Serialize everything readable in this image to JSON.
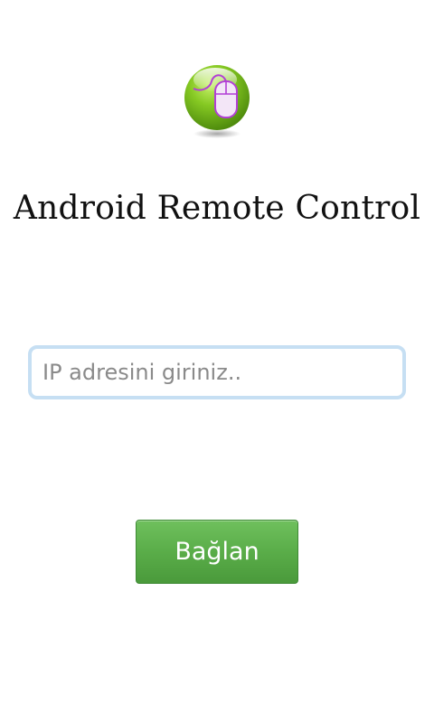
{
  "app": {
    "logo_icon": "mouse-logo-icon",
    "title": "Android Remote Control"
  },
  "form": {
    "ip_placeholder": "IP adresini giriniz..",
    "ip_value": "",
    "connect_label": "Bağlan"
  },
  "colors": {
    "background": "#ffffff",
    "field_border": "#c6dff3",
    "button_green": "#5aad49",
    "button_text": "#ffffff",
    "logo_green": "#7bc41f",
    "logo_mouse_outline": "#b23fd6"
  }
}
